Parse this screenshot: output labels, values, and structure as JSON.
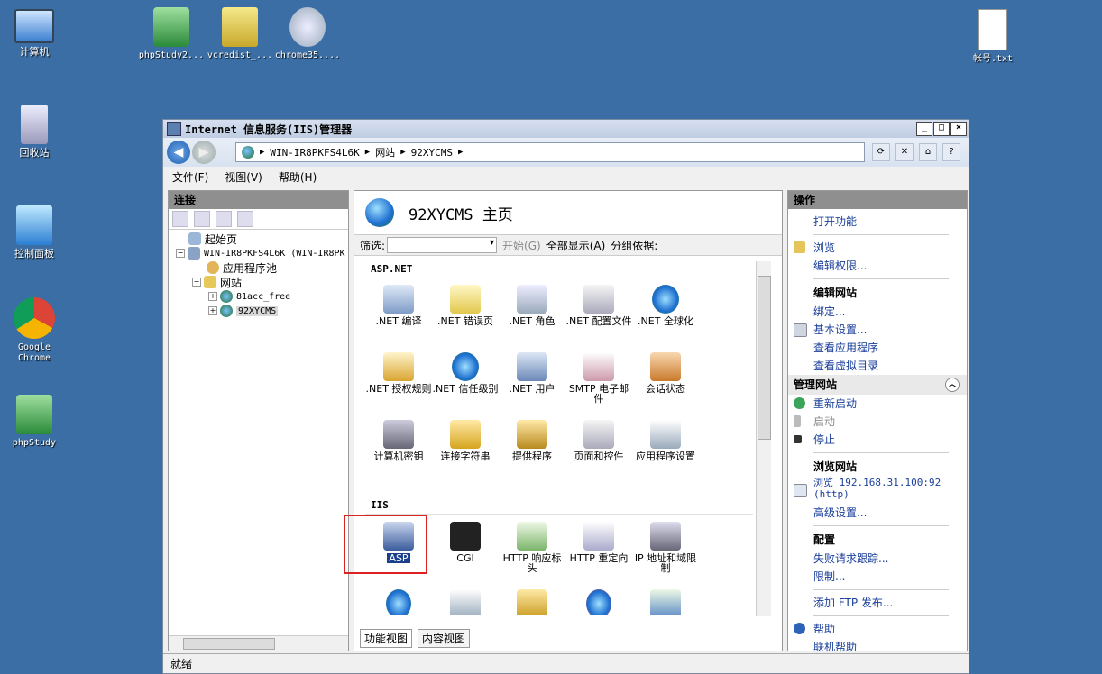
{
  "desktop": {
    "icons": [
      {
        "label": "计算机"
      },
      {
        "label": "phpStudy2..."
      },
      {
        "label": "vcredist_..."
      },
      {
        "label": "chrome35...."
      },
      {
        "label": "帐号.txt"
      },
      {
        "label": "回收站"
      },
      {
        "label": "控制面板"
      },
      {
        "label": "Google\nChrome"
      },
      {
        "label": "phpStudy"
      }
    ]
  },
  "window": {
    "title": "Internet 信息服务(IIS)管理器",
    "controls": [
      "_",
      "□",
      "×"
    ],
    "address": [
      "WIN-IR8PKFS4L6K",
      "网站",
      "92XYCMS"
    ],
    "menu": [
      "文件(F)",
      "视图(V)",
      "帮助(H)"
    ],
    "status": "就绪"
  },
  "connections": {
    "header": "连接",
    "tree": [
      {
        "label": "起始页"
      },
      {
        "label": "WIN-IR8PKFS4L6K (WIN-IR8PK"
      },
      {
        "label": "应用程序池"
      },
      {
        "label": "网站"
      },
      {
        "label": "81acc_free"
      },
      {
        "label": "92XYCMS"
      }
    ]
  },
  "main": {
    "title": "92XYCMS 主页",
    "filter": {
      "label": "筛选:",
      "start": "开始(G)",
      "show_all": "全部显示(A)",
      "group_by": "分组依据:"
    },
    "groups": [
      {
        "name": "ASP.NET",
        "features": [
          ".NET 编译",
          ".NET 错误页",
          ".NET 角色",
          ".NET 配置文件",
          ".NET 全球化",
          ".NET 授权规则",
          ".NET 信任级别",
          ".NET 用户",
          "SMTP 电子邮件",
          "会话状态",
          "计算机密钥",
          "连接字符串",
          "提供程序",
          "页面和控件",
          "应用程序设置"
        ]
      },
      {
        "name": "IIS",
        "features": [
          "ASP",
          "CGI",
          "HTTP 响应标头",
          "HTTP 重定向",
          "IP 地址和域限制"
        ]
      }
    ],
    "view_tabs": [
      "功能视图",
      "内容视图"
    ]
  },
  "actions": {
    "header": "操作",
    "top": [
      "打开功能",
      "浏览",
      "编辑权限..."
    ],
    "edit_site_title": "编辑网站",
    "edit_site": [
      "绑定...",
      "基本设置...",
      "查看应用程序",
      "查看虚拟目录"
    ],
    "manage_header": "管理网站",
    "manage": [
      "重新启动",
      "启动",
      "停止"
    ],
    "browse_title": "浏览网站",
    "browse_link": "浏览 192.168.31.100:92\n(http)",
    "advanced": "高级设置...",
    "config_title": "配置",
    "config": [
      "失败请求跟踪...",
      "限制...",
      "添加 FTP 发布..."
    ],
    "help": [
      "帮助",
      "联机帮助"
    ]
  }
}
